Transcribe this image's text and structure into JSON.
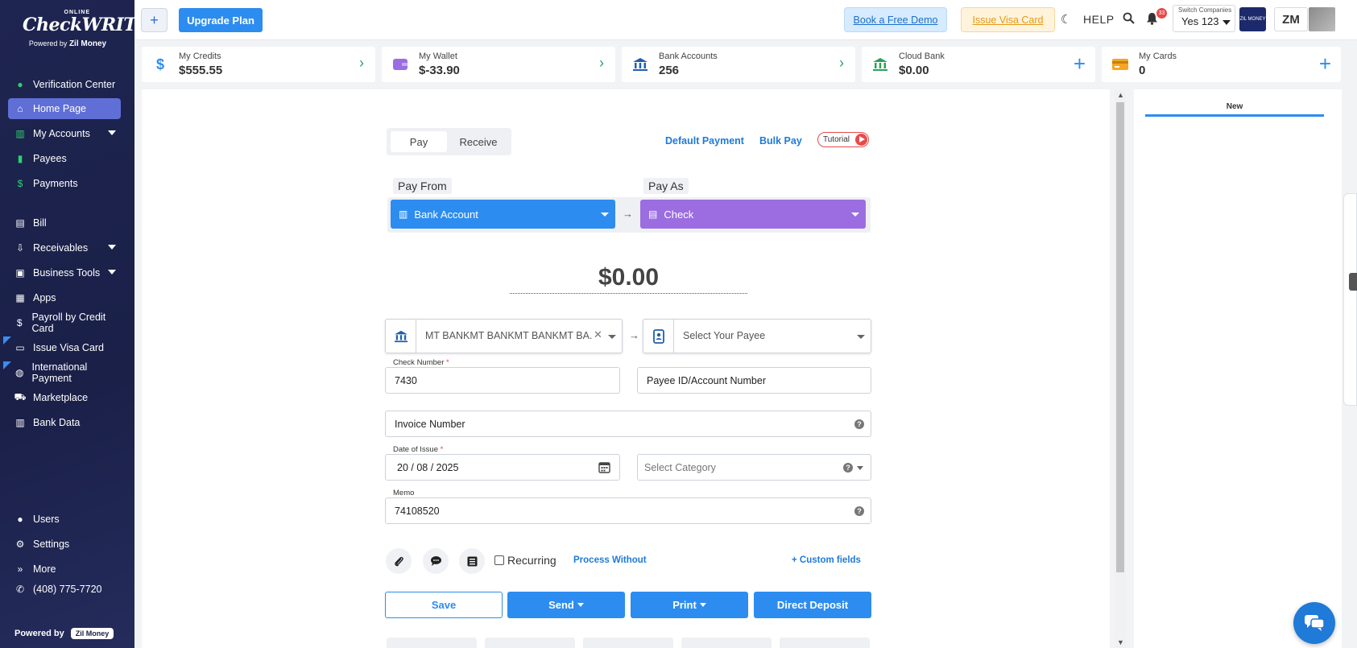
{
  "sidebar": {
    "logo": {
      "online": "ONLINE",
      "brand": "CheckWRITER",
      "powered_by": "Powered by",
      "zil": "Zil Money"
    },
    "items": [
      {
        "label": "Verification Center",
        "icon": "check-circle-icon"
      },
      {
        "label": "Home Page",
        "icon": "home-icon",
        "active": true
      },
      {
        "label": "My Accounts",
        "icon": "bank-icon",
        "caret": true
      },
      {
        "label": "Payees",
        "icon": "payee-icon"
      },
      {
        "label": "Payments",
        "icon": "dollar-icon"
      },
      {
        "label": "Bill",
        "icon": "bill-icon"
      },
      {
        "label": "Receivables",
        "icon": "receivables-icon",
        "caret": true
      },
      {
        "label": "Business Tools",
        "icon": "briefcase-icon",
        "caret": true
      },
      {
        "label": "Apps",
        "icon": "apps-icon"
      },
      {
        "label": "Payroll by Credit Card",
        "icon": "dollar-icon"
      },
      {
        "label": "Issue Visa Card",
        "icon": "card-icon"
      },
      {
        "label": "International Payment",
        "icon": "globe-icon"
      },
      {
        "label": "Marketplace",
        "icon": "cart-icon"
      },
      {
        "label": "Bank Data",
        "icon": "bank-icon"
      },
      {
        "label": "Users",
        "icon": "user-icon"
      },
      {
        "label": "Settings",
        "icon": "gear-icon"
      },
      {
        "label": "More",
        "icon": "double-chevron-icon"
      },
      {
        "label": "(408) 775-7720",
        "icon": "phone-icon"
      }
    ],
    "powered_bottom": "Powered by",
    "powered_badge": "Zil Money"
  },
  "topbar": {
    "plus": "+",
    "upgrade": "Upgrade Plan",
    "demo": "Book a Free Demo",
    "visa": "Issue Visa Card",
    "help": "HELP",
    "notif_count": "33",
    "switch_label": "Switch Companies",
    "switch_value": "Yes 123",
    "company_logo": "ZIL MONEY",
    "initials": "ZM"
  },
  "cards": [
    {
      "title": "My Credits",
      "value": "$555.55",
      "action": "chevron-right-icon"
    },
    {
      "title": "My Wallet",
      "value": "$-33.90",
      "action": "chevron-right-icon"
    },
    {
      "title": "Bank Accounts",
      "value": "256",
      "action": "chevron-right-icon"
    },
    {
      "title": "Cloud Bank",
      "value": "$0.00",
      "action": "plus-icon"
    },
    {
      "title": "My Cards",
      "value": "0",
      "action": "plus-icon"
    }
  ],
  "form": {
    "tabs": [
      "Pay",
      "Receive"
    ],
    "default_payment": "Default Payment",
    "bulk_pay": "Bulk Pay",
    "tutorial": "Tutorial",
    "pay_from_label": "Pay From",
    "pay_from_value": "Bank Account",
    "pay_as_label": "Pay As",
    "pay_as_value": "Check",
    "amount": "$0.00",
    "bank_value": "MT BANKMT BANKMT BANKMT BA...",
    "payee_placeholder": "Select Your Payee",
    "check_number_label": "Check Number",
    "check_number": "7430",
    "payee_id_placeholder": "Payee ID/Account Number",
    "invoice_placeholder": "Invoice Number",
    "date_label": "Date of Issue",
    "date_value": "20 / 08 / 2025",
    "category_placeholder": "Select Category",
    "memo_label": "Memo",
    "memo_value": "74108520",
    "recurring": "Recurring",
    "process_without": "Process Without",
    "custom_fields": "+ Custom fields",
    "save": "Save",
    "send": "Send",
    "print": "Print",
    "direct_deposit": "Direct Deposit",
    "required_mark": "*",
    "help_mark": "?"
  },
  "right_panel": {
    "tab": "New"
  },
  "colors": {
    "sidebar_bg": "#1e2550",
    "active_nav": "#5f6fd6",
    "primary_blue": "#2d8cf0",
    "pay_as_purple": "#9b6de0",
    "credits_blue": "#2d8cf0",
    "wallet_purple": "#9b6de0",
    "bank_blue": "#1f5faf",
    "cloud_green": "#2aa15a",
    "cards_orange": "#f5a623"
  }
}
